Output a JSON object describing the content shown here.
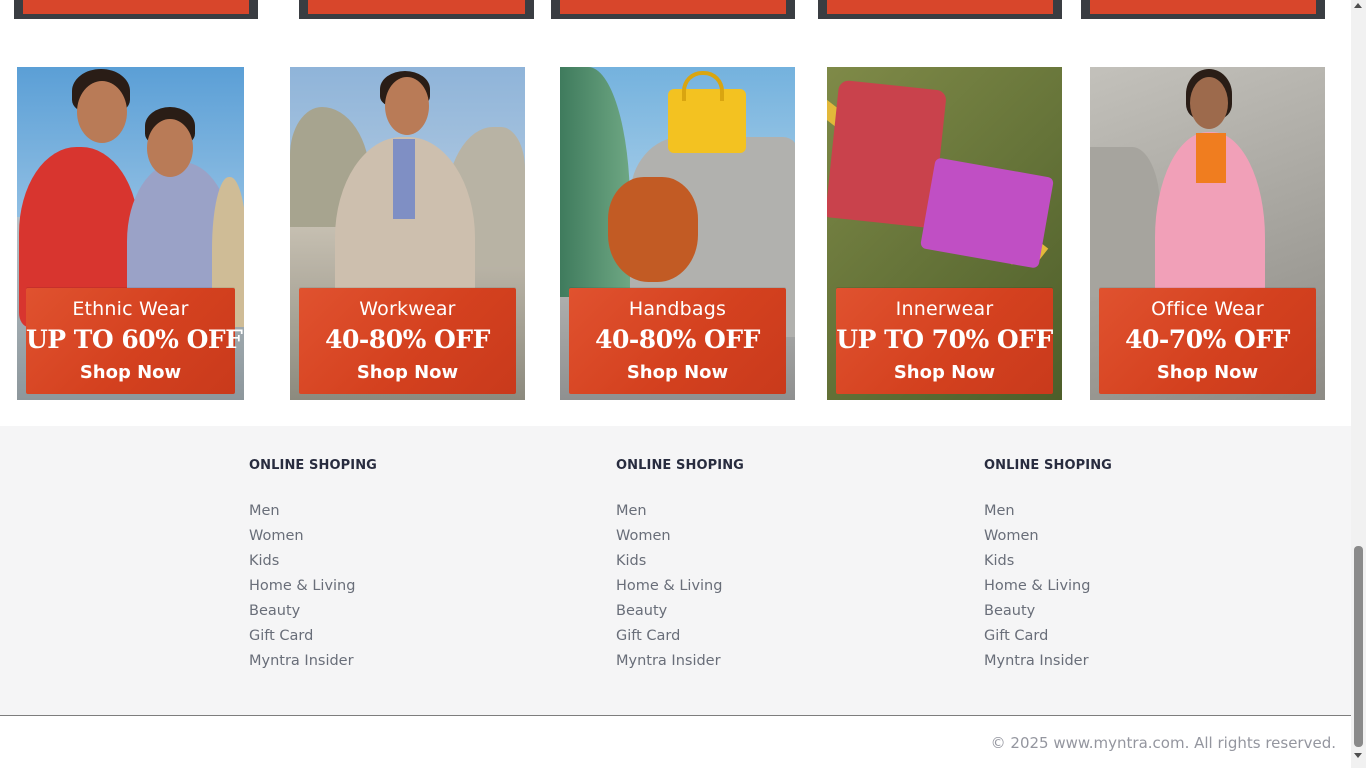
{
  "promos": [
    {
      "title": "Ethnic Wear",
      "offer": "UP TO 60% OFF",
      "cta": "Shop Now"
    },
    {
      "title": "Workwear",
      "offer": "40-80% OFF",
      "cta": "Shop Now"
    },
    {
      "title": "Handbags",
      "offer": "40-80% OFF",
      "cta": "Shop Now"
    },
    {
      "title": "Innerwear",
      "offer": "UP TO 70% OFF",
      "cta": "Shop Now"
    },
    {
      "title": "Office Wear",
      "offer": "40-70% OFF",
      "cta": "Shop Now"
    }
  ],
  "footer": {
    "columns": [
      {
        "heading": "ONLINE SHOPING",
        "links": [
          "Men",
          "Women",
          "Kids",
          "Home & Living",
          "Beauty",
          "Gift Card",
          "Myntra Insider"
        ]
      },
      {
        "heading": "ONLINE SHOPING",
        "links": [
          "Men",
          "Women",
          "Kids",
          "Home & Living",
          "Beauty",
          "Gift Card",
          "Myntra Insider"
        ]
      },
      {
        "heading": "ONLINE SHOPING",
        "links": [
          "Men",
          "Women",
          "Kids",
          "Home & Living",
          "Beauty",
          "Gift Card",
          "Myntra Insider"
        ]
      }
    ],
    "copyright": "© 2025 www.myntra.com. All rights reserved."
  },
  "colors": {
    "promo_orange": "#d4411f",
    "footer_bg": "#f5f5f6",
    "heading_text": "#282c3f",
    "link_text": "#696e79"
  }
}
